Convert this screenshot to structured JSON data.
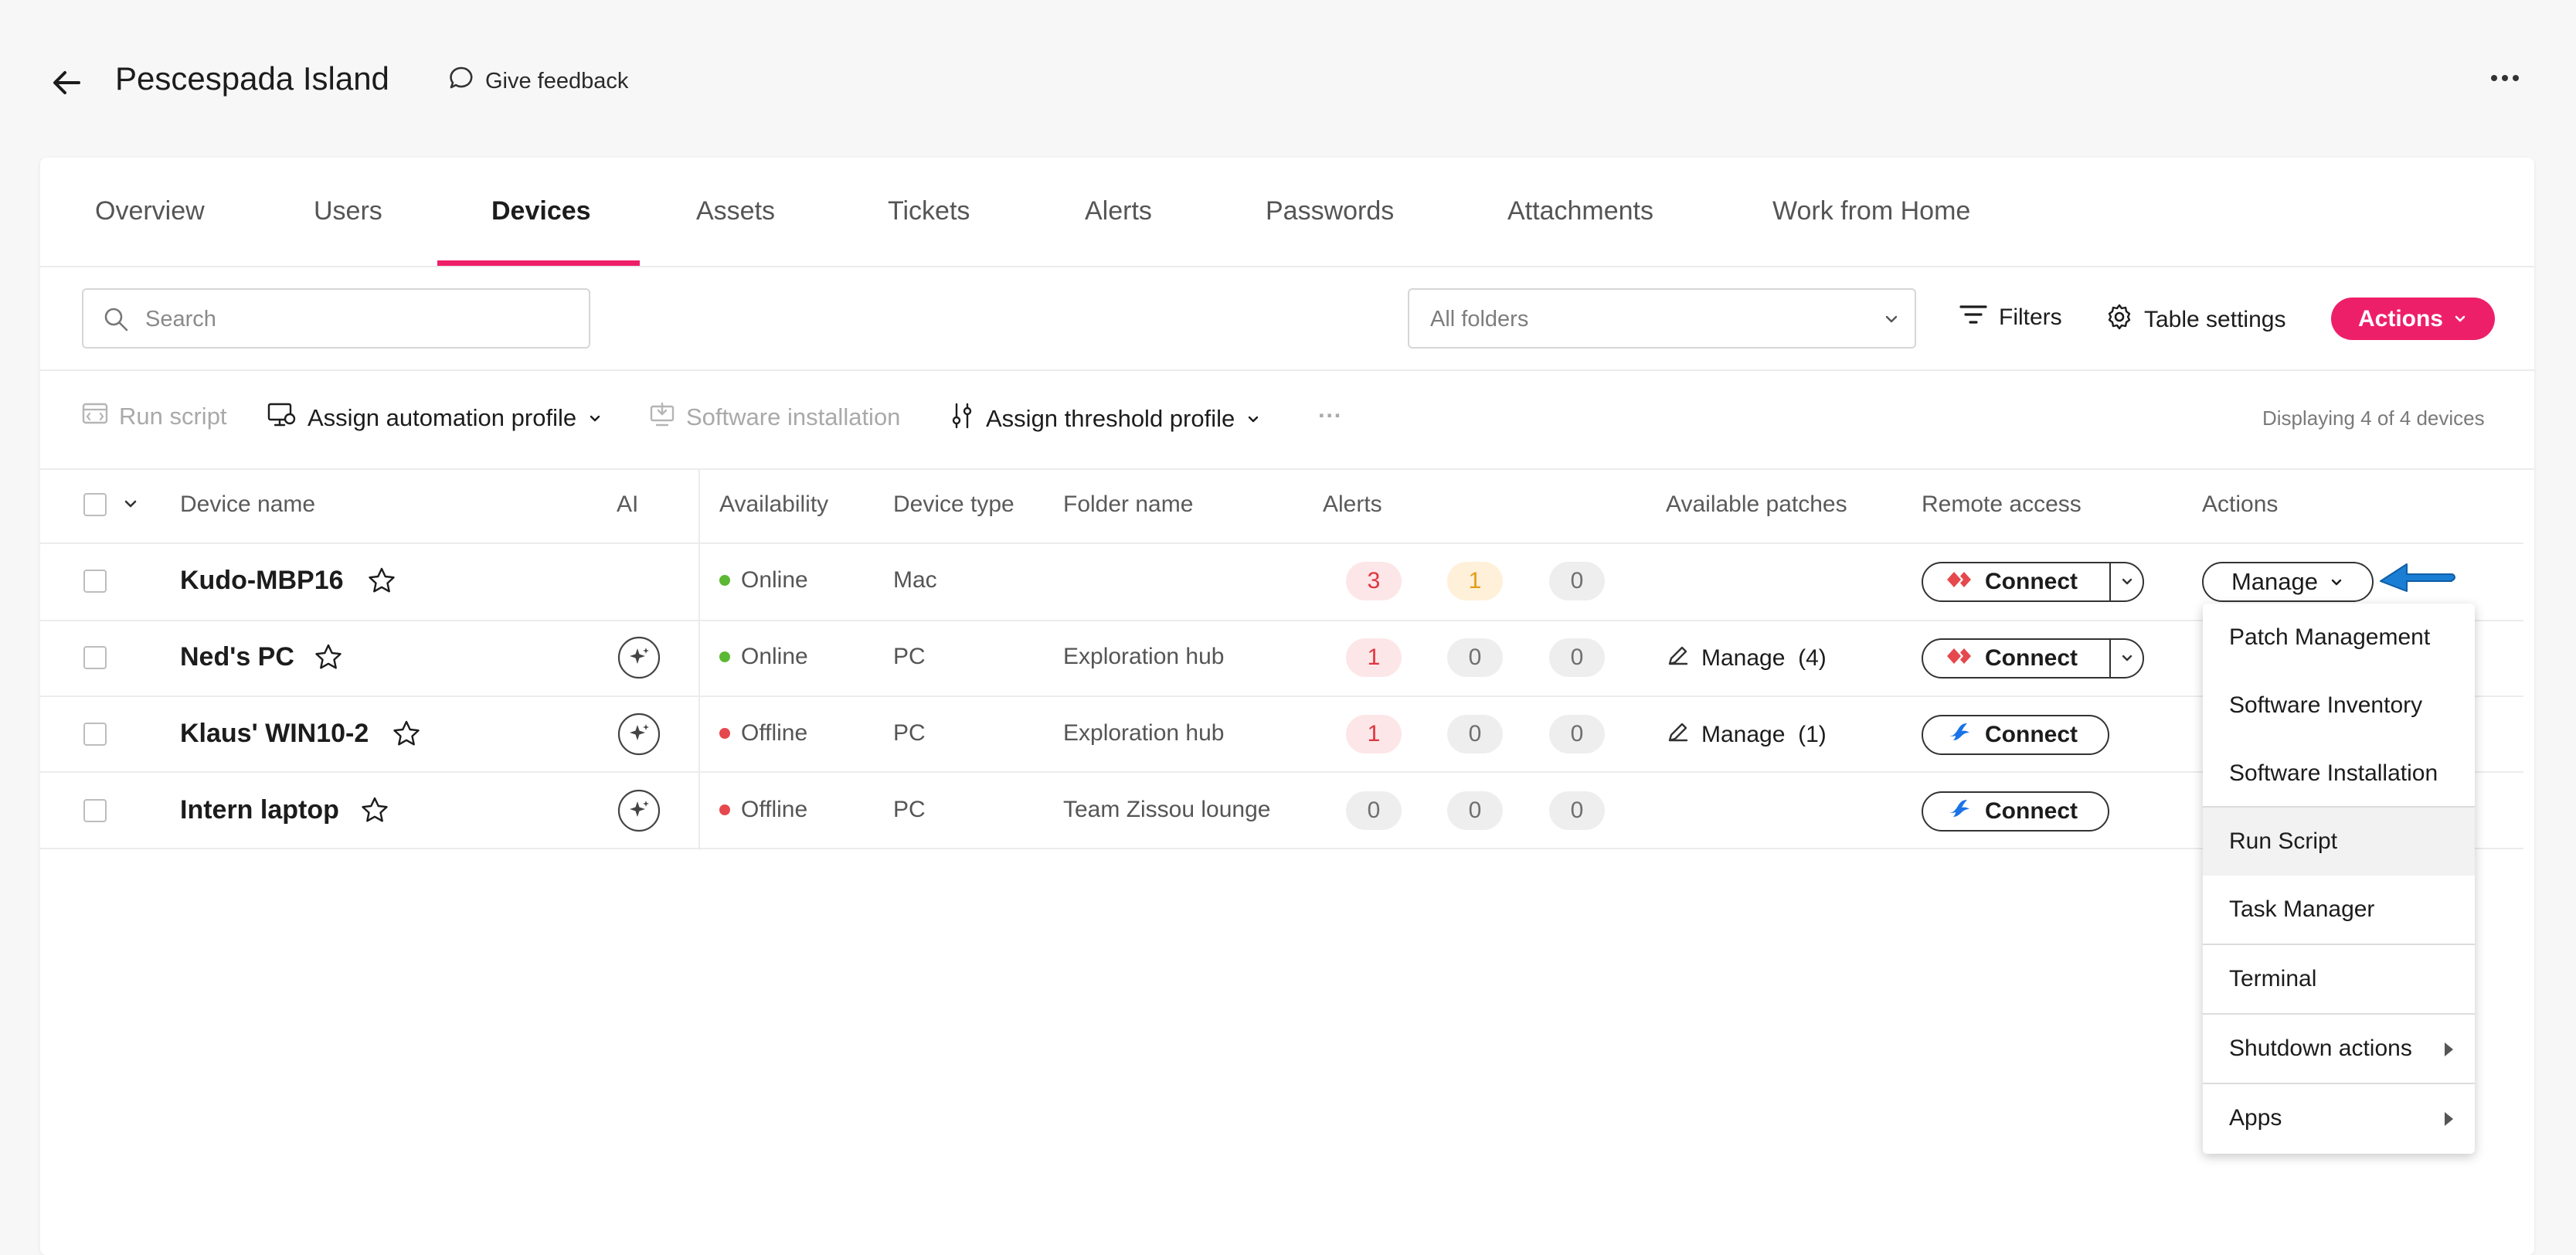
{
  "header": {
    "title": "Pescespada Island",
    "feedback_label": "Give feedback"
  },
  "tabs": [
    {
      "label": "Overview"
    },
    {
      "label": "Users"
    },
    {
      "label": "Devices",
      "active": true
    },
    {
      "label": "Assets"
    },
    {
      "label": "Tickets"
    },
    {
      "label": "Alerts"
    },
    {
      "label": "Passwords"
    },
    {
      "label": "Attachments"
    },
    {
      "label": "Work from Home"
    }
  ],
  "toolbar": {
    "search_placeholder": "Search",
    "folder_select_value": "All folders",
    "filters_label": "Filters",
    "table_settings_label": "Table settings",
    "actions_label": "Actions",
    "run_script_label": "Run script",
    "assign_automation_label": "Assign automation profile",
    "software_installation_label": "Software installation",
    "assign_threshold_label": "Assign threshold profile",
    "more_label": "···",
    "displaying_text": "Displaying 4 of 4 devices"
  },
  "table": {
    "columns": {
      "device_name": "Device name",
      "ai": "AI",
      "availability": "Availability",
      "device_type": "Device type",
      "folder_name": "Folder name",
      "alerts": "Alerts",
      "available_patches": "Available patches",
      "remote_access": "Remote access",
      "actions": "Actions"
    },
    "rows": [
      {
        "name": "Kudo-MBP16",
        "availability": "Online",
        "status_color": "#5cb833",
        "type": "Mac",
        "folder": "",
        "alerts": [
          "3",
          "1",
          "0"
        ],
        "patches": "",
        "connect_label": "Connect",
        "connect_tool": "red-diamond",
        "has_split": true
      },
      {
        "name": "Ned's PC",
        "availability": "Online",
        "status_color": "#5cb833",
        "type": "PC",
        "folder": "Exploration hub",
        "alerts": [
          "1",
          "0",
          "0"
        ],
        "patches": "Manage  (4)",
        "connect_label": "Connect",
        "connect_tool": "red-diamond",
        "has_split": true
      },
      {
        "name": "Klaus' WIN10-2",
        "availability": "Offline",
        "status_color": "#e5484d",
        "type": "PC",
        "folder": "Exploration hub",
        "alerts": [
          "1",
          "0",
          "0"
        ],
        "patches": "Manage  (1)",
        "connect_label": "Connect",
        "connect_tool": "blue-splashtop",
        "has_split": false
      },
      {
        "name": "Intern laptop",
        "availability": "Offline",
        "status_color": "#e5484d",
        "type": "PC",
        "folder": "Team Zissou lounge",
        "alerts": [
          "0",
          "0",
          "0"
        ],
        "patches": "",
        "connect_label": "Connect",
        "connect_tool": "blue-splashtop",
        "has_split": false
      }
    ]
  },
  "manage_button_label": "Manage",
  "manage_menu": [
    {
      "label": "Patch Management"
    },
    {
      "label": "Software Inventory"
    },
    {
      "label": "Software Installation"
    },
    {
      "label": "Run Script",
      "highlighted": true
    },
    {
      "label": "Task Manager"
    },
    {
      "label": "Terminal"
    },
    {
      "label": "Shutdown actions",
      "submenu": true
    },
    {
      "label": "Apps",
      "submenu": true
    }
  ],
  "colors": {
    "accent": "#ee1f69",
    "online": "#5cb833",
    "offline": "#e5484d",
    "pointer_arrow": "#1a7fd4"
  }
}
